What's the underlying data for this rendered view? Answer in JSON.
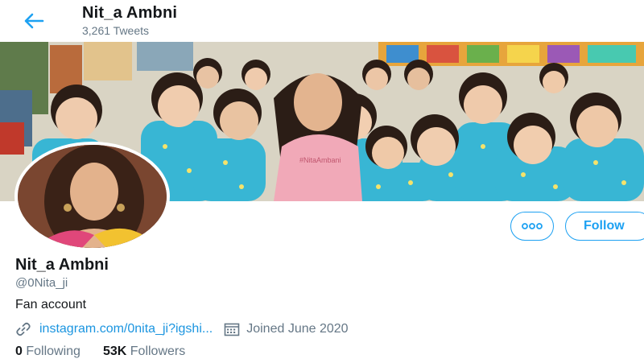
{
  "header": {
    "name": "Nit_a Ambni",
    "tweet_count": "3,261 Tweets",
    "back_icon": "arrow-left-icon"
  },
  "banner": {
    "overlay_text": "#NitaAmbani",
    "colors": {
      "wall": "#d9d4c4",
      "shirt": "#38b6d4",
      "saree": "#f1a9b8"
    }
  },
  "actions": {
    "more_icon": "more-icon",
    "follow_label": "Follow",
    "accent_color": "#1da1f2"
  },
  "profile": {
    "name": "Nit_a Ambni",
    "handle": "@0Nita_ji",
    "bio": "Fan account",
    "link": "instagram.com/0nita_ji?igshi...",
    "link_icon": "link-icon",
    "joined": "Joined June 2020",
    "calendar_icon": "calendar-icon"
  },
  "stats": {
    "following_count": "0",
    "following_label": "Following",
    "followers_count": "53K",
    "followers_label": "Followers"
  }
}
